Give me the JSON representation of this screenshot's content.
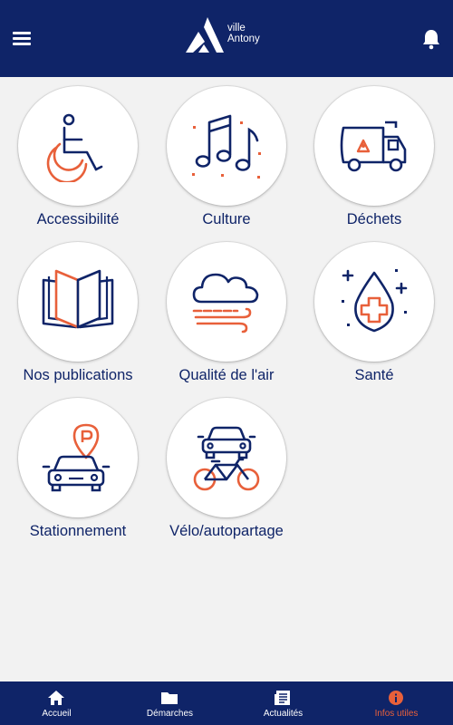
{
  "header": {
    "logo_line1": "ville",
    "logo_line2": "Antony"
  },
  "tiles": [
    {
      "label": "Accessibilité",
      "icon": "wheelchair-icon"
    },
    {
      "label": "Culture",
      "icon": "music-notes-icon"
    },
    {
      "label": "Déchets",
      "icon": "garbage-truck-icon"
    },
    {
      "label": "Nos publications",
      "icon": "open-book-icon"
    },
    {
      "label": "Qualité de l'air",
      "icon": "cloud-wind-icon"
    },
    {
      "label": "Santé",
      "icon": "medical-drop-icon"
    },
    {
      "label": "Stationnement",
      "icon": "parking-car-icon"
    },
    {
      "label": "Vélo/autopartage",
      "icon": "car-bike-icon"
    }
  ],
  "tabs": [
    {
      "label": "Accueil",
      "icon": "home-icon"
    },
    {
      "label": "Démarches",
      "icon": "folder-icon"
    },
    {
      "label": "Actualités",
      "icon": "newspaper-icon"
    },
    {
      "label": "Infos utiles",
      "icon": "info-icon"
    }
  ],
  "active_tab": "Infos utiles",
  "colors": {
    "primary": "#0f2468",
    "accent": "#e8603a",
    "background": "#f2f2f2"
  }
}
